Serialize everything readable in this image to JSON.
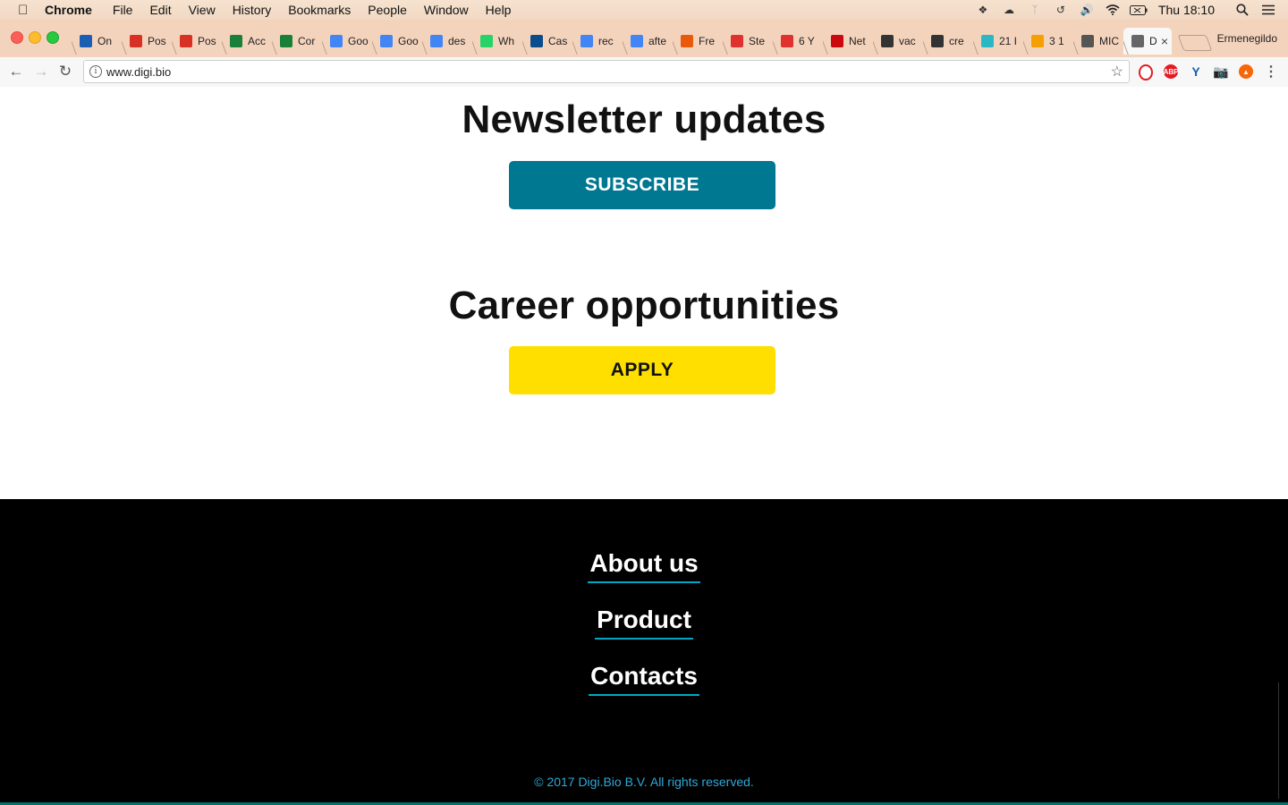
{
  "menubar": {
    "app": "Chrome",
    "items": [
      "File",
      "Edit",
      "View",
      "History",
      "Bookmarks",
      "People",
      "Window",
      "Help"
    ],
    "clock": "Thu 18:10"
  },
  "browser": {
    "tabs": [
      {
        "label": "On",
        "icon": "yammer-icon",
        "color": "#1a5fb4"
      },
      {
        "label": "Pos",
        "icon": "gmail-icon",
        "color": "#d93025"
      },
      {
        "label": "Pos",
        "icon": "gmail-icon",
        "color": "#d93025"
      },
      {
        "label": "Acc",
        "icon": "sheets-icon",
        "color": "#188038"
      },
      {
        "label": "Cor",
        "icon": "sheets-icon",
        "color": "#188038"
      },
      {
        "label": "Goo",
        "icon": "calendar-icon",
        "color": "#4285f4"
      },
      {
        "label": "Goo",
        "icon": "translate-icon",
        "color": "#4285f4"
      },
      {
        "label": "des",
        "icon": "google-icon",
        "color": "#4285f4"
      },
      {
        "label": "Wh",
        "icon": "whatsapp-icon",
        "color": "#25d366"
      },
      {
        "label": "Cas",
        "icon": "rai-icon",
        "color": "#0b4c8c"
      },
      {
        "label": "rec",
        "icon": "google-icon",
        "color": "#4285f4"
      },
      {
        "label": "afte",
        "icon": "google-icon",
        "color": "#4285f4"
      },
      {
        "label": "Fre",
        "icon": "m-icon",
        "color": "#e8590c"
      },
      {
        "label": "Ste",
        "icon": "t-icon",
        "color": "#e03131"
      },
      {
        "label": "6 Y",
        "icon": "w-icon",
        "color": "#e03131"
      },
      {
        "label": "Net",
        "icon": "netflix-icon",
        "color": "#c9080f"
      },
      {
        "label": "vac",
        "icon": "page-icon",
        "color": "#333333"
      },
      {
        "label": "cre",
        "icon": "page-icon",
        "color": "#333333"
      },
      {
        "label": "21 I",
        "icon": "globe-icon",
        "color": "#2bb7c4"
      },
      {
        "label": "3 1",
        "icon": "ring-icon",
        "color": "#f59f00"
      },
      {
        "label": "MIC",
        "icon": "smile-icon",
        "color": "#555555"
      },
      {
        "label": "D",
        "icon": "document-icon",
        "color": "#666666",
        "active": true
      }
    ],
    "profile": "Ermenegildo",
    "url": "www.digi.bio"
  },
  "main": {
    "newsletter_title": "Newsletter updates",
    "subscribe_label": "SUBSCRIBE",
    "career_title": "Career opportunities",
    "apply_label": "APPLY"
  },
  "footer": {
    "links": [
      "About us",
      "Product",
      "Contacts"
    ],
    "copyright": "© 2017 Digi.Bio B.V. All rights reserved."
  },
  "colors": {
    "subscribe_bg": "#007891",
    "apply_bg": "#fedf00",
    "footer_bg": "#000000",
    "link_underline": "#00a7c4",
    "copyright": "#2ea9d8"
  }
}
